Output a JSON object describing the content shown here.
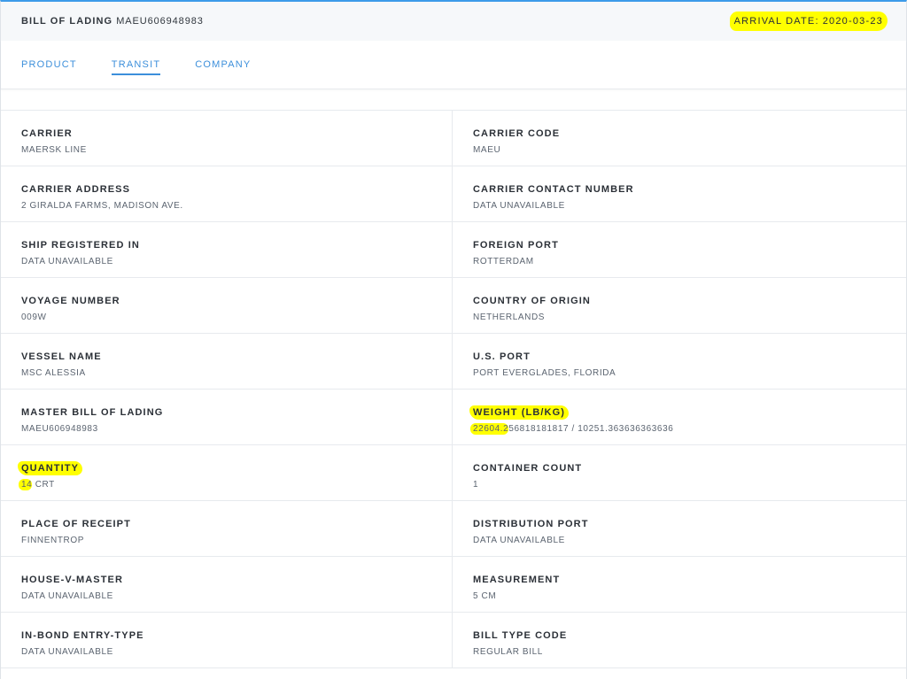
{
  "header": {
    "bol_label": "BILL OF LADING",
    "bol_number": "MAEU606948983",
    "arrival_label": "ARRIVAL DATE:",
    "arrival_value": "2020-03-23"
  },
  "tabs": [
    {
      "label": "PRODUCT",
      "active": false
    },
    {
      "label": "TRANSIT",
      "active": true
    },
    {
      "label": "COMPANY",
      "active": false
    }
  ],
  "fields": {
    "carrier": {
      "label": "CARRIER",
      "value": "MAERSK LINE"
    },
    "carrier_code": {
      "label": "CARRIER CODE",
      "value": "MAEU"
    },
    "carrier_address": {
      "label": "CARRIER ADDRESS",
      "value": "2 GIRALDA FARMS, MADISON AVE."
    },
    "carrier_contact": {
      "label": "CARRIER CONTACT NUMBER",
      "value": "DATA UNAVAILABLE"
    },
    "ship_registered": {
      "label": "SHIP REGISTERED IN",
      "value": "DATA UNAVAILABLE"
    },
    "foreign_port": {
      "label": "FOREIGN PORT",
      "value": "ROTTERDAM"
    },
    "voyage_number": {
      "label": "VOYAGE NUMBER",
      "value": "009W"
    },
    "country_origin": {
      "label": "COUNTRY OF ORIGIN",
      "value": "NETHERLANDS"
    },
    "vessel_name": {
      "label": "VESSEL NAME",
      "value": "MSC ALESSIA"
    },
    "us_port": {
      "label": "U.S. PORT",
      "value": "PORT EVERGLADES, FLORIDA"
    },
    "master_bol": {
      "label": "MASTER BILL OF LADING",
      "value": "MAEU606948983"
    },
    "weight": {
      "label": "WEIGHT (LB/KG)",
      "value_highlight": "22604.2",
      "value_rest": "56818181817 / 10251.363636363636"
    },
    "quantity": {
      "label": "QUANTITY",
      "value_highlight": "14",
      "value_rest": "CRT"
    },
    "container_count": {
      "label": "CONTAINER COUNT",
      "value": "1"
    },
    "place_receipt": {
      "label": "PLACE OF RECEIPT",
      "value": "FINNENTROP"
    },
    "distribution_port": {
      "label": "DISTRIBUTION PORT",
      "value": "DATA UNAVAILABLE"
    },
    "house_v_master": {
      "label": "HOUSE-V-MASTER",
      "value": "DATA UNAVAILABLE"
    },
    "measurement": {
      "label": "MEASUREMENT",
      "value": "5 CM"
    },
    "in_bond": {
      "label": "IN-BOND ENTRY-TYPE",
      "value": "DATA UNAVAILABLE"
    },
    "bill_type": {
      "label": "BILL TYPE CODE",
      "value": "REGULAR BILL"
    }
  },
  "colors": {
    "accent": "#3c8fdb",
    "highlight": "#ffff00"
  }
}
